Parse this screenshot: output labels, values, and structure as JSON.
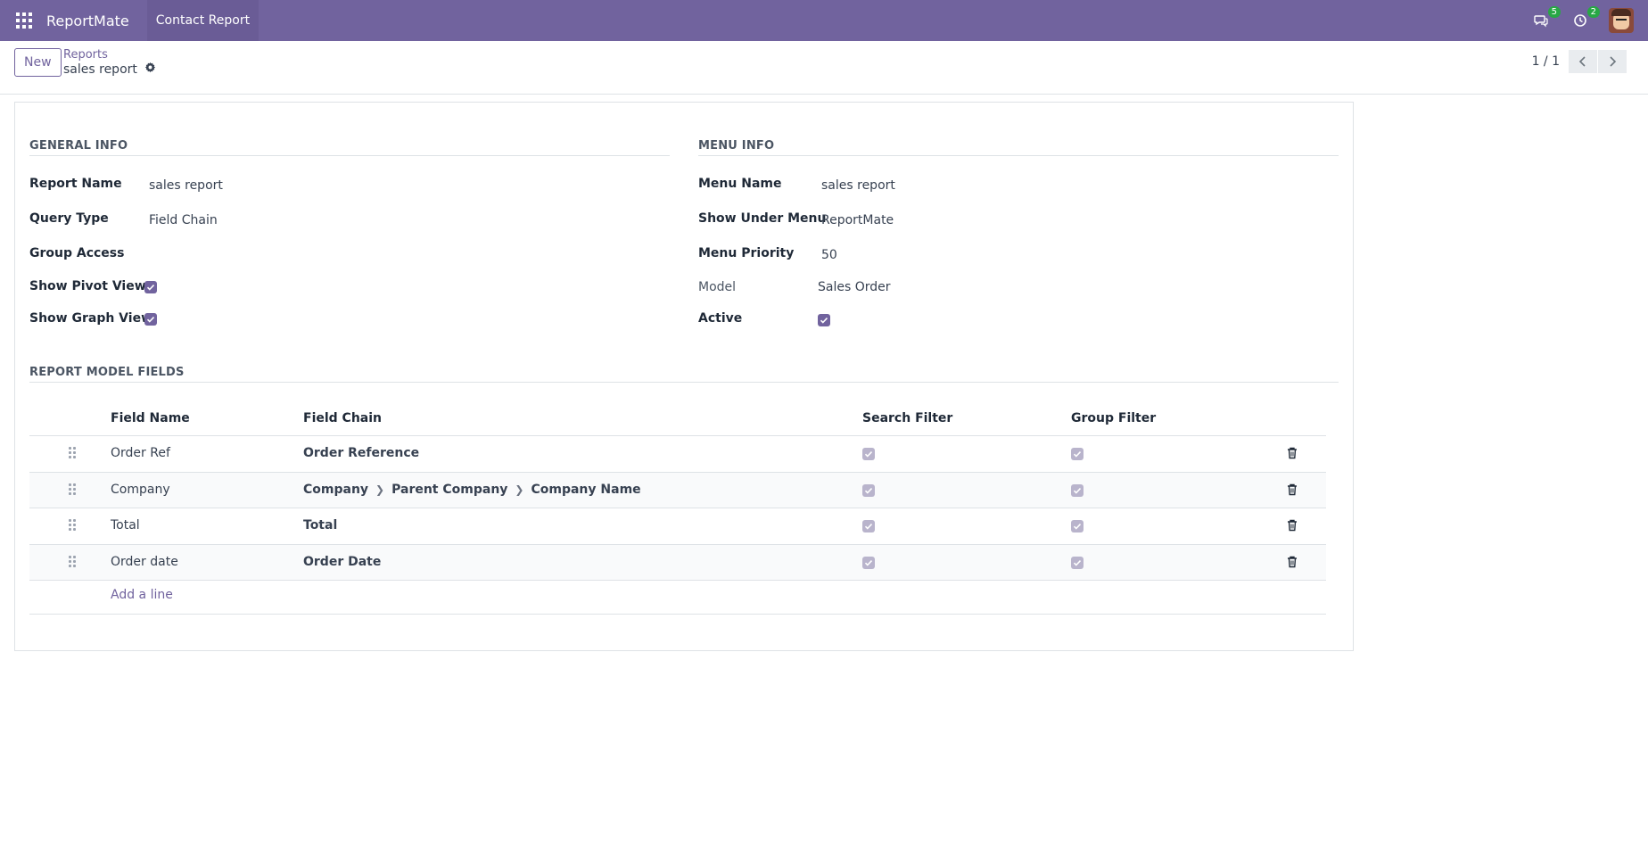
{
  "topbar": {
    "brand": "ReportMate",
    "menu_item": "Contact Report",
    "messages_count": "5",
    "activities_count": "2"
  },
  "controlpanel": {
    "new_label": "New",
    "breadcrumb_parent": "Reports",
    "breadcrumb_current": "sales report",
    "pager_value": "1 / 1"
  },
  "general_info": {
    "title": "GENERAL INFO",
    "report_name_label": "Report Name",
    "report_name_value": "sales report",
    "query_type_label": "Query Type",
    "query_type_value": "Field Chain",
    "group_access_label": "Group Access",
    "show_pivot_label": "Show Pivot View",
    "show_pivot_checked": true,
    "show_graph_label": "Show Graph View",
    "show_graph_checked": true
  },
  "menu_info": {
    "title": "MENU INFO",
    "menu_name_label": "Menu Name",
    "menu_name_value": "sales report",
    "show_under_label": "Show Under Menu",
    "show_under_value": "ReportMate",
    "menu_priority_label": "Menu Priority",
    "menu_priority_value": "50",
    "model_label": "Model",
    "model_value": "Sales Order",
    "active_label": "Active",
    "active_checked": true
  },
  "fields": {
    "title": "REPORT MODEL FIELDS",
    "columns": {
      "field_name": "Field Name",
      "field_chain": "Field Chain",
      "search_filter": "Search Filter",
      "group_filter": "Group Filter"
    },
    "rows": [
      {
        "field_name": "Order Ref",
        "chain": [
          "Order Reference"
        ],
        "search": true,
        "group": true
      },
      {
        "field_name": "Company",
        "chain": [
          "Company",
          "Parent Company",
          "Company Name"
        ],
        "search": true,
        "group": true
      },
      {
        "field_name": "Total",
        "chain": [
          "Total"
        ],
        "search": true,
        "group": true
      },
      {
        "field_name": "Order date",
        "chain": [
          "Order Date"
        ],
        "search": true,
        "group": true
      }
    ],
    "add_line": "Add a line"
  },
  "colors": {
    "brand": "#71639e",
    "badge": "#28a745"
  }
}
